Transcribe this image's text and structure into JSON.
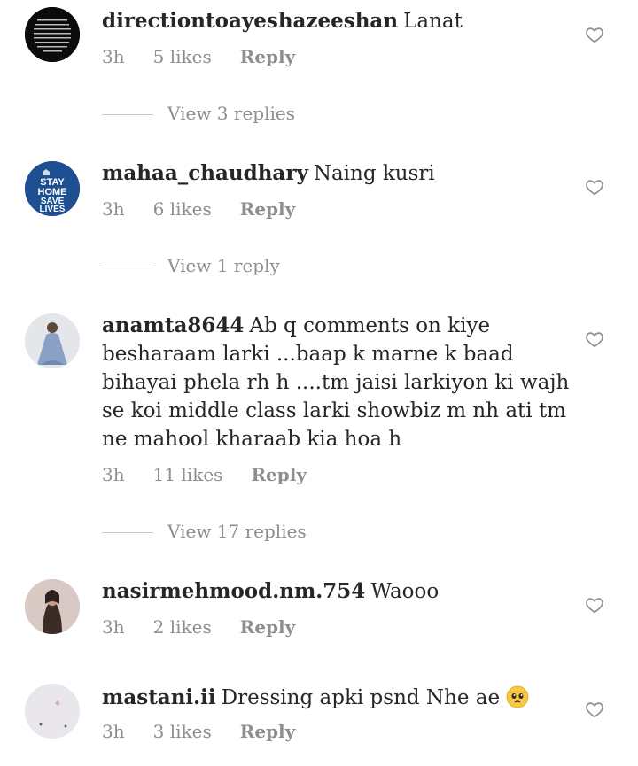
{
  "comments": [
    {
      "username": "directiontoayeshazeeshan",
      "text": "Lanat",
      "time": "3h",
      "likes": "5 likes",
      "reply": "Reply",
      "view_replies": "View 3 replies"
    },
    {
      "username": "mahaa_chaudhary",
      "text": "Naing kusri",
      "time": "3h",
      "likes": "6 likes",
      "reply": "Reply",
      "view_replies": "View 1 reply",
      "avatar_text": [
        "STAY",
        "HOME",
        "SAVE",
        "LIVES"
      ]
    },
    {
      "username": "anamta8644",
      "text": "Ab q comments on kiye besharaam larki ...baap k marne k baad bihayai phela rh h ....tm jaisi larkiyon ki wajh se koi middle class larki showbiz m nh ati tm ne mahool kharaab kia hoa h",
      "time": "3h",
      "likes": "11 likes",
      "reply": "Reply",
      "view_replies": "View 17 replies"
    },
    {
      "username": "nasirmehmood.nm.754",
      "text": "Waooo",
      "time": "3h",
      "likes": "2 likes",
      "reply": "Reply"
    },
    {
      "username": "mastani.ii",
      "text": "Dressing apki psnd Nhe ae",
      "time": "3h",
      "likes": "3 likes",
      "reply": "Reply",
      "emoji": "pleading-face-emoji"
    }
  ],
  "colors": {
    "text": "#262626",
    "meta": "#8e8e8e",
    "divider": "#c7c7c7",
    "avatar_blue": "#1d4f91"
  }
}
